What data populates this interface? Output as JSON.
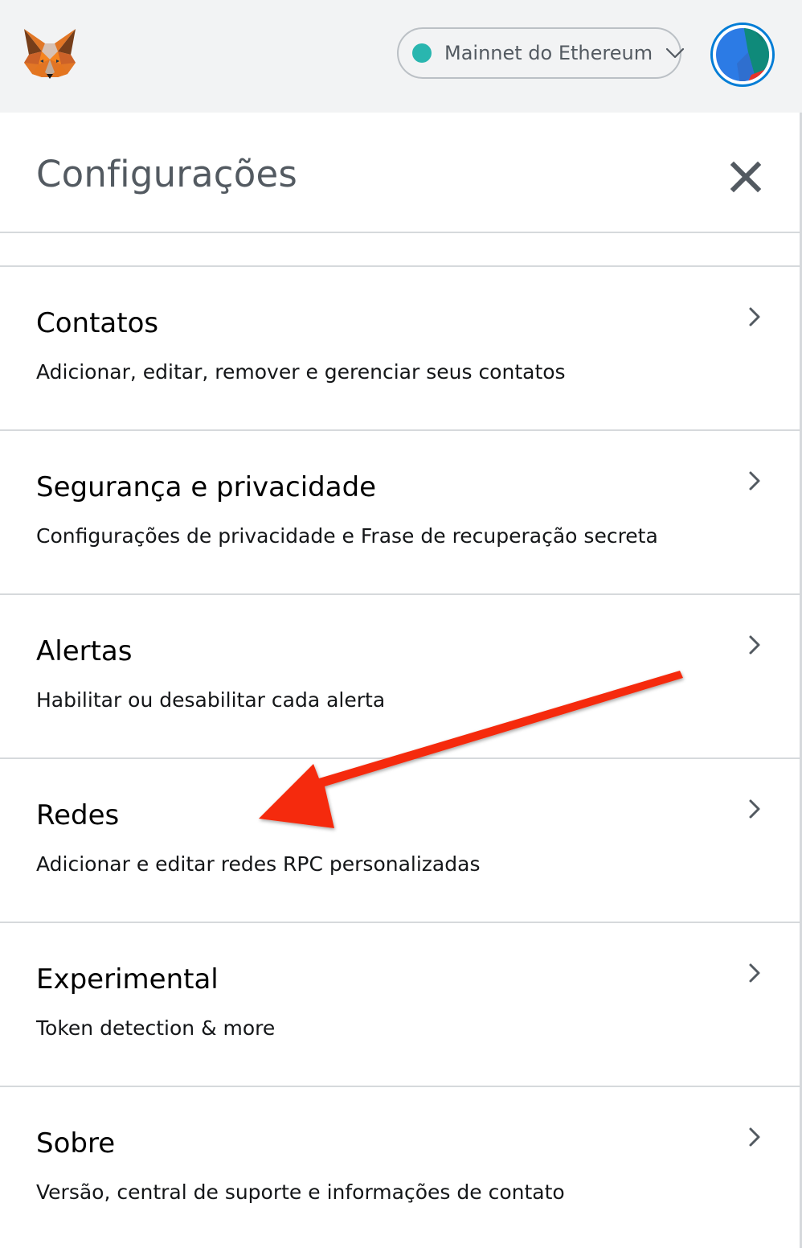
{
  "header": {
    "logo_icon": "metamask-fox-icon",
    "network": {
      "name": "Mainnet do Ethereum",
      "status_color": "#29b6af"
    },
    "account_avatar_icon": "jazzicon-avatar"
  },
  "settings": {
    "title": "Configurações",
    "close_icon": "close-icon",
    "items": [
      {
        "title": "Contatos",
        "description": "Adicionar, editar, remover e gerenciar seus contatos"
      },
      {
        "title": "Segurança e privacidade",
        "description": "Configurações de privacidade e Frase de recuperação secreta"
      },
      {
        "title": "Alertas",
        "description": "Habilitar ou desabilitar cada alerta"
      },
      {
        "title": "Redes",
        "description": "Adicionar e editar redes RPC personalizadas"
      },
      {
        "title": "Experimental",
        "description": "Token detection & more"
      },
      {
        "title": "Sobre",
        "description": "Versão, central de suporte e informações de contato"
      }
    ]
  },
  "annotation": {
    "arrow_color": "#f52c0c",
    "points_to": "Redes"
  }
}
